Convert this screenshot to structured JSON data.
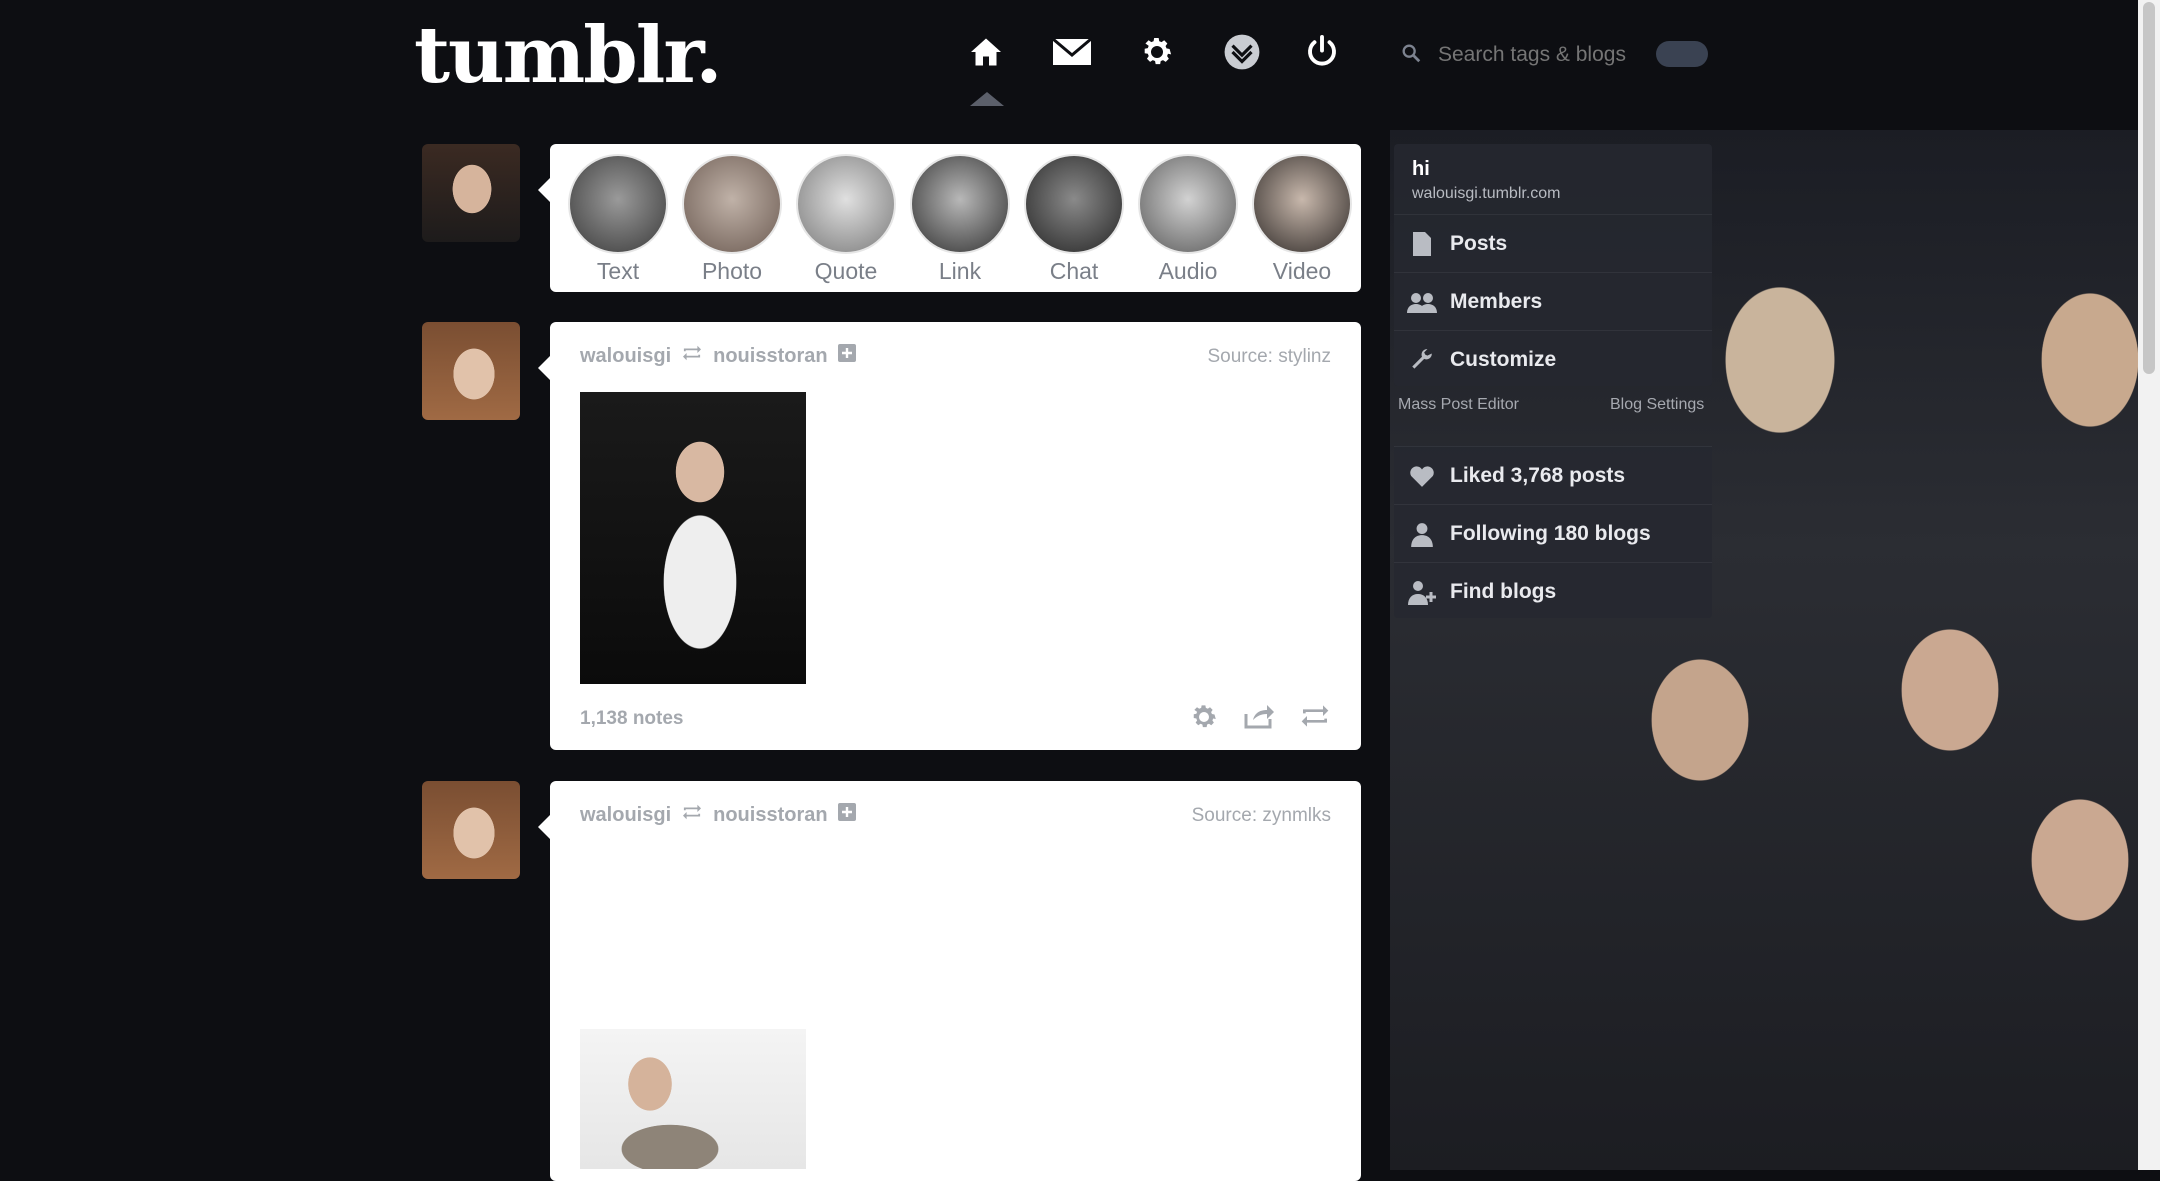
{
  "brand": {
    "logo": "tumblr."
  },
  "nav": {
    "icons": [
      "home-icon",
      "mail-icon",
      "gear-icon",
      "inbox-icon",
      "power-icon"
    ],
    "search_placeholder": "Search tags & blogs"
  },
  "post_types": [
    "Text",
    "Photo",
    "Quote",
    "Link",
    "Chat",
    "Audio",
    "Video"
  ],
  "posts": [
    {
      "user": "walouisgi",
      "reblogged_from": "nouisstoran",
      "source": "Source: stylinz",
      "notes": "1,138 notes"
    },
    {
      "user": "walouisgi",
      "reblogged_from": "nouisstoran",
      "source": "Source: zynmlks"
    }
  ],
  "sidebar": {
    "blog_title": "hi",
    "blog_url": "walouisgi.tumblr.com",
    "menu": [
      {
        "label": "Posts",
        "icon": "document-icon"
      },
      {
        "label": "Members",
        "icon": "members-icon"
      },
      {
        "label": "Customize",
        "icon": "wrench-icon"
      }
    ],
    "mass_post_editor": "Mass Post Editor",
    "blog_settings": "Blog Settings",
    "stats": [
      {
        "label": "Liked 3,768 posts",
        "icon": "heart-icon"
      },
      {
        "label": "Following 180 blogs",
        "icon": "user-icon"
      },
      {
        "label": "Find blogs",
        "icon": "add-user-icon"
      }
    ]
  }
}
